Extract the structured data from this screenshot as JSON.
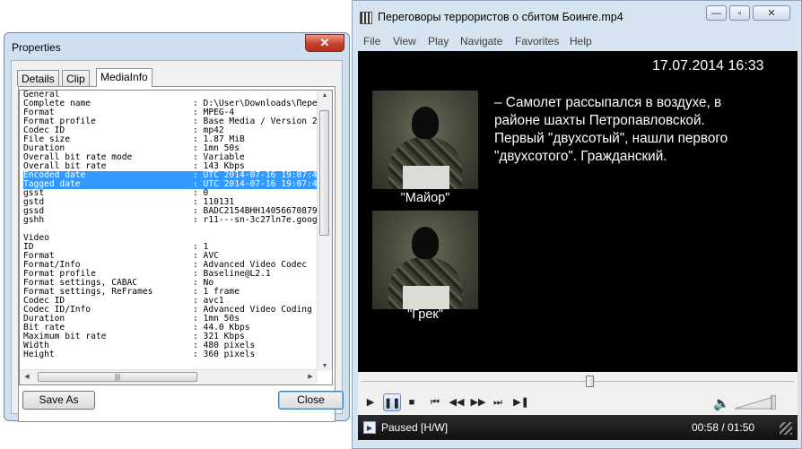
{
  "properties": {
    "title": "Properties",
    "close_glyph": "✕",
    "tabs": [
      "Details",
      "Clip",
      "MediaInfo"
    ],
    "active_tab": "MediaInfo",
    "mediainfo": [
      {
        "k": "General",
        "v": ""
      },
      {
        "k": "Complete name",
        "v": ": D:\\User\\Downloads\\Пере"
      },
      {
        "k": "Format",
        "v": ": MPEG-4"
      },
      {
        "k": "Format profile",
        "v": ": Base Media / Version 2"
      },
      {
        "k": "Codec ID",
        "v": ": mp42"
      },
      {
        "k": "File size",
        "v": ": 1.87 MiB"
      },
      {
        "k": "Duration",
        "v": ": 1mn 50s"
      },
      {
        "k": "Overall bit rate mode",
        "v": ": Variable"
      },
      {
        "k": "Overall bit rate",
        "v": ": 143 Kbps"
      },
      {
        "k": "Encoded date",
        "v": ": UTC 2014-07-16 19:07:4",
        "selected": true
      },
      {
        "k": "Tagged date",
        "v": ": UTC 2014-07-16 19:07:4",
        "selected": true
      },
      {
        "k": "gsst",
        "v": ": 0"
      },
      {
        "k": "gstd",
        "v": ": 110131"
      },
      {
        "k": "gssd",
        "v": ": BADC2154BHH14056670879"
      },
      {
        "k": "gshh",
        "v": ": r11---sn-3c27ln7e.goog"
      },
      {
        "k": "",
        "v": ""
      },
      {
        "k": "Video",
        "v": ""
      },
      {
        "k": "ID",
        "v": ": 1"
      },
      {
        "k": "Format",
        "v": ": AVC"
      },
      {
        "k": "Format/Info",
        "v": ": Advanced Video Codec"
      },
      {
        "k": "Format profile",
        "v": ": Baseline@L2.1"
      },
      {
        "k": "Format settings, CABAC",
        "v": ": No"
      },
      {
        "k": "Format settings, ReFrames",
        "v": ": 1 frame"
      },
      {
        "k": "Codec ID",
        "v": ": avc1"
      },
      {
        "k": "Codec ID/Info",
        "v": ": Advanced Video Coding"
      },
      {
        "k": "Duration",
        "v": ": 1mn 50s"
      },
      {
        "k": "Bit rate",
        "v": ": 44.0 Kbps"
      },
      {
        "k": "Maximum bit rate",
        "v": ": 321 Kbps"
      },
      {
        "k": "Width",
        "v": ": 480 pixels"
      },
      {
        "k": "Height",
        "v": ": 360 pixels"
      }
    ],
    "save_as_label": "Save As",
    "close_label": "Close"
  },
  "player": {
    "title": "Переговоры террористов о сбитом Боинге.mp4",
    "window_buttons": {
      "minimize": "—",
      "restore": "▫",
      "close": "✕"
    },
    "menu": [
      "File",
      "View",
      "Play",
      "Navigate",
      "Favorites",
      "Help"
    ],
    "video": {
      "timestamp": "17.07.2014   16:33",
      "caption_top": "\"Майор\"",
      "caption_bottom": "\"Грек\"",
      "subtitle_lines": [
        "– Самолет рассыпался в воздухе, в",
        "районе шахты Петропавловской.",
        "Первый \"двухсотый\", нашли первого",
        "\"двухсотого\". Гражданский."
      ]
    },
    "seek_fraction": 0.527,
    "controls": {
      "play": "▶",
      "pause": "❚❚",
      "stop": "■",
      "prev": "⏮",
      "rewind": "◀◀",
      "forward": "▶▶",
      "next": "⏭",
      "frame_step": "▶❚",
      "volume": "🔈"
    },
    "status": {
      "text": "Paused [H/W]",
      "time": "00:58 / 01:50",
      "icon_glyph": "▶"
    }
  },
  "colors": {
    "selection": "#3399ff",
    "close_red": "#c7412b",
    "video_bg": "#000000"
  }
}
